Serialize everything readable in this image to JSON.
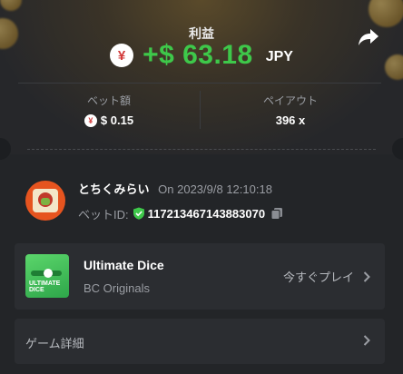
{
  "profit": {
    "label": "利益",
    "currency_symbol": "¥",
    "amount": "+$ 63.18",
    "currency": "JPY"
  },
  "stats": {
    "bet_amount_label": "ベット額",
    "bet_amount_symbol": "¥",
    "bet_amount_value": "$ 0.15",
    "payout_label": "ペイアウト",
    "payout_value": "396 x"
  },
  "user": {
    "name": "とちくみらい",
    "date": "On 2023/9/8 12:10:18",
    "bet_id_label": "ベットID:",
    "bet_id": "117213467143883070"
  },
  "game": {
    "thumb_title": "ULTIMATE DICE",
    "name": "Ultimate Dice",
    "provider": "BC Originals",
    "play_label": "今すぐプレイ"
  },
  "details": {
    "label": "ゲーム詳細"
  },
  "icons": {
    "share": "share-icon",
    "verified": "shield-check-icon",
    "copy": "copy-icon",
    "chevron": "chevron-right-icon"
  },
  "colors": {
    "profit_green": "#3ec84a",
    "avatar_orange": "#e6541f",
    "verified_green": "#3ec84a"
  }
}
